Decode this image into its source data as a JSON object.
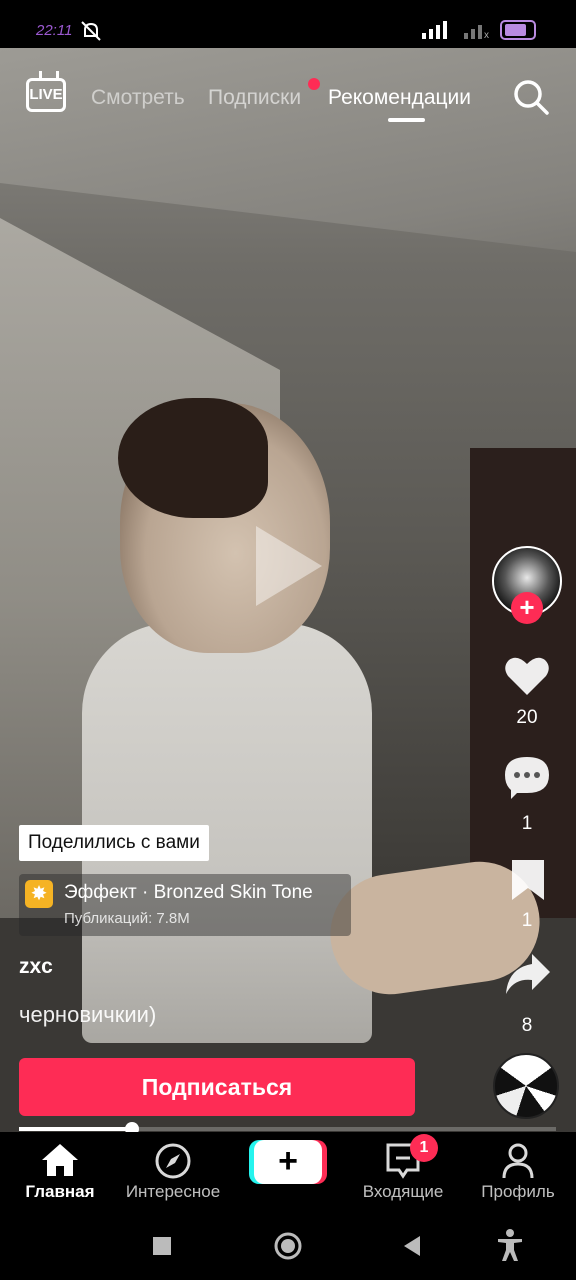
{
  "status_bar": {
    "time": "22:11"
  },
  "top_nav": {
    "live_label": "LIVE",
    "tabs": [
      {
        "label": "Смотреть"
      },
      {
        "label": "Подписки"
      },
      {
        "label": "Рекомендации",
        "active": true
      }
    ]
  },
  "rail": {
    "likes": "20",
    "comments": "1",
    "saves": "1",
    "shares": "8"
  },
  "caption": {
    "shared_label": "Поделились с вами",
    "effect_name": "Эффект · Bronzed Skin Tone",
    "effect_posts": "Публикаций: 7.8M",
    "author": "zxc",
    "description": "черновичкии)",
    "subscribe_label": "Подписаться"
  },
  "playback": {
    "progress": 0.21
  },
  "bottom_nav": {
    "items": [
      {
        "label": "Главная",
        "active": true
      },
      {
        "label": "Интересное"
      },
      {
        "label": "Входящие"
      },
      {
        "label": "Профиль"
      }
    ],
    "create_label": "+",
    "inbox_badge": "1"
  },
  "colors": {
    "accent": "#fe2c55",
    "cyan": "#25f4ee"
  }
}
